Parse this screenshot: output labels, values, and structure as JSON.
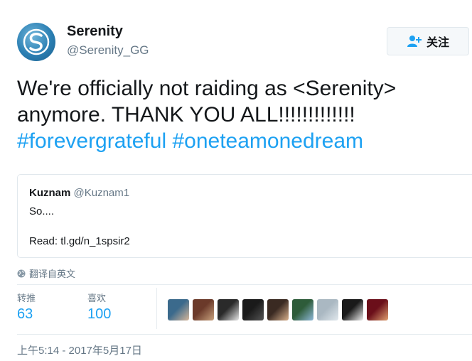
{
  "author": {
    "name": "Serenity",
    "handle": "@Serenity_GG"
  },
  "follow_button": {
    "label": "关注"
  },
  "tweet": {
    "text_line1": "We're officially not raiding as <Serenity>",
    "text_line2": "anymore. THANK YOU ALL!!!!!!!!!!!!!",
    "hashtag1": "#forevergrateful",
    "hashtag2": "#oneteamonedream"
  },
  "quoted_tweet": {
    "name": "Kuznam",
    "handle": "@Kuznam1",
    "line1": "So....",
    "line2": "Read: tl.gd/n_1spsir2"
  },
  "translate": {
    "label": "翻译自英文"
  },
  "stats": {
    "retweets_label": "转推",
    "retweets_value": "63",
    "likes_label": "喜欢",
    "likes_value": "100"
  },
  "likers": [
    {
      "name": "liker-avatar-1",
      "colors": [
        "#3b6a8c",
        "#d8b79a"
      ]
    },
    {
      "name": "liker-avatar-2",
      "colors": [
        "#6b3a2a",
        "#c9a27e"
      ]
    },
    {
      "name": "liker-avatar-3",
      "colors": [
        "#2a2a2a",
        "#e8e8e8"
      ]
    },
    {
      "name": "liker-avatar-4",
      "colors": [
        "#1a1a1a",
        "#555555"
      ]
    },
    {
      "name": "liker-avatar-5",
      "colors": [
        "#3a2a22",
        "#d9b08c"
      ]
    },
    {
      "name": "liker-avatar-6",
      "colors": [
        "#2e5c3a",
        "#8fb8d9"
      ]
    },
    {
      "name": "liker-avatar-7",
      "colors": [
        "#aab8c2",
        "#e1e8ed"
      ]
    },
    {
      "name": "liker-avatar-8",
      "colors": [
        "#1a1a1a",
        "#f2f2f2"
      ]
    },
    {
      "name": "liker-avatar-9",
      "colors": [
        "#6b0f1a",
        "#e0a070"
      ]
    }
  ],
  "timestamp": "上午5:14 - 2017年5月17日",
  "colors": {
    "link_blue": "#1da1f2",
    "secondary_text": "#657786",
    "border": "#e1e8ed"
  }
}
